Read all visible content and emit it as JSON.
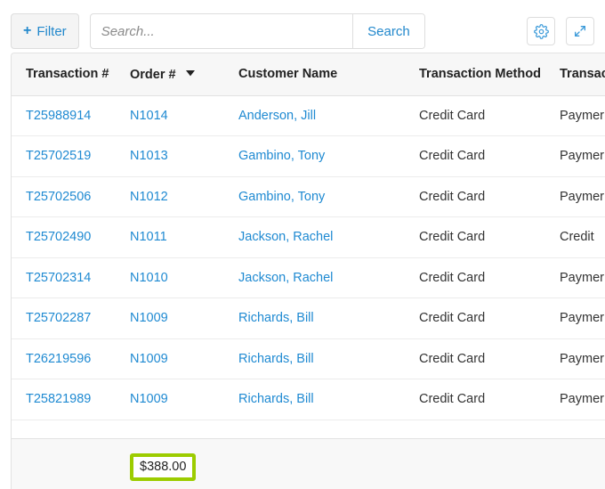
{
  "toolbar": {
    "filter_label": "Filter",
    "filter_icon": "plus-icon",
    "search_placeholder": "Search...",
    "search_value": "",
    "search_button_label": "Search",
    "settings_icon": "gear-icon",
    "expand_icon": "expand-arrows-icon"
  },
  "table": {
    "columns": [
      {
        "label": "Transaction #",
        "sorted": false
      },
      {
        "label": "Order #",
        "sorted": true,
        "sort_direction": "desc",
        "sort_icon": "caret-down-icon"
      },
      {
        "label": "Customer Name",
        "sorted": false
      },
      {
        "label": "Transaction Method",
        "sorted": false
      },
      {
        "label": "Transac",
        "sorted": false,
        "truncated": true
      }
    ],
    "rows": [
      {
        "transaction": "T25988914",
        "order": "N1014",
        "customer": "Anderson, Jill",
        "method": "Credit Card",
        "type": "Paymer"
      },
      {
        "transaction": "T25702519",
        "order": "N1013",
        "customer": "Gambino, Tony",
        "method": "Credit Card",
        "type": "Paymer"
      },
      {
        "transaction": "T25702506",
        "order": "N1012",
        "customer": "Gambino, Tony",
        "method": "Credit Card",
        "type": "Paymer"
      },
      {
        "transaction": "T25702490",
        "order": "N1011",
        "customer": "Jackson, Rachel",
        "method": "Credit Card",
        "type": "Credit"
      },
      {
        "transaction": "T25702314",
        "order": "N1010",
        "customer": "Jackson, Rachel",
        "method": "Credit Card",
        "type": "Paymer"
      },
      {
        "transaction": "T25702287",
        "order": "N1009",
        "customer": "Richards, Bill",
        "method": "Credit Card",
        "type": "Paymer"
      },
      {
        "transaction": "T26219596",
        "order": "N1009",
        "customer": "Richards, Bill",
        "method": "Credit Card",
        "type": "Paymer"
      },
      {
        "transaction": "T25821989",
        "order": "N1009",
        "customer": "Richards, Bill",
        "method": "Credit Card",
        "type": "Paymer"
      }
    ],
    "footer": {
      "total_value": "$388.00",
      "highlight_color": "#9ccc00"
    }
  },
  "colors": {
    "link": "#1f8ad2",
    "accent": "#2288cc",
    "header_bg": "#f7f7f7",
    "footer_bg": "#f8f8f8",
    "border": "#e2e2e2",
    "highlight": "#9ccc00"
  }
}
